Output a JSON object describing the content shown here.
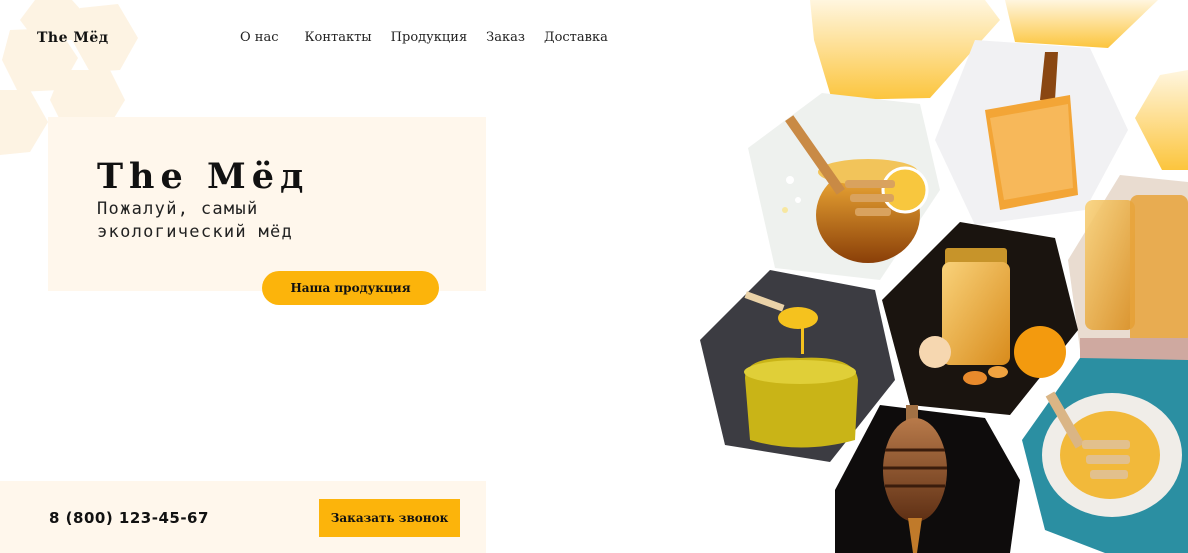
{
  "logo": "The Мёд",
  "nav": [
    "О нас",
    "Контакты",
    "Продукция",
    "Заказ",
    "Доставка"
  ],
  "hero": {
    "title": "The Мёд",
    "subtitle_line1": "Пожалуй, самый",
    "subtitle_line2": "экологический мёд",
    "button": "Наша продукция"
  },
  "footer": {
    "phone": "8 (800) 123-45-67",
    "call_button": "Заказать звонок"
  },
  "colors": {
    "accent": "#fcb40b",
    "panel_bg": "#fff7ec"
  },
  "gallery": [
    "honey-dipper-jar-photo",
    "honeycomb-spoon-photo",
    "honey-jars-photo",
    "honey-pot-dipper-photo",
    "honey-jar-tangerine-photo",
    "honey-dipper-dark-photo",
    "honey-bowl-dipper-photo"
  ]
}
